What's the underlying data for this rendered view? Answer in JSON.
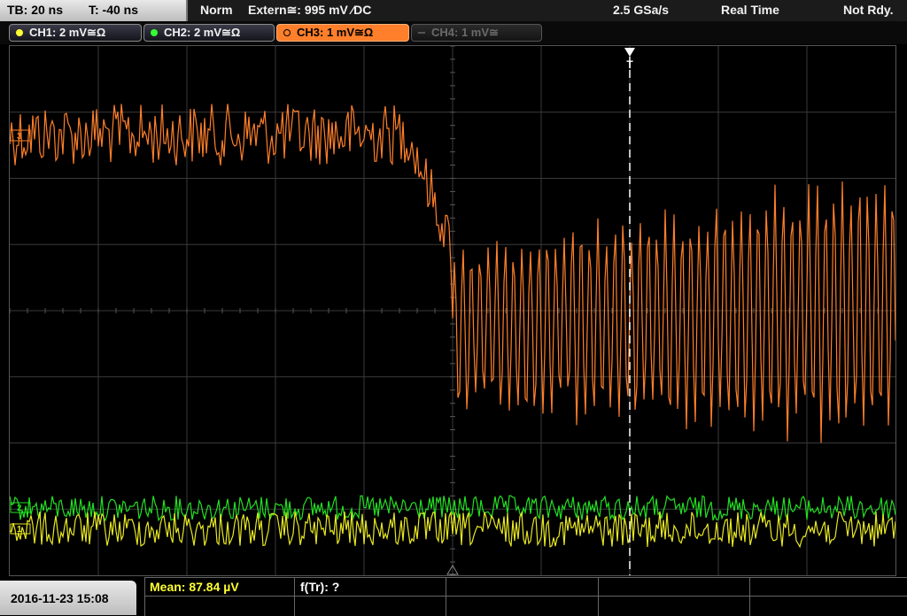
{
  "header": {
    "timebase": "TB: 20 ns",
    "trigger_time": "T: -40 ns",
    "mode": "Norm",
    "trigger_source": "Extern≅: 995 mV ⁄DC",
    "sample_rate": "2.5 GSa/s",
    "acquisition": "Real Time",
    "status": "Not Rdy."
  },
  "channels": [
    {
      "label": "CH1: 2 mV≅Ω",
      "color": "#ffff33",
      "state": "on"
    },
    {
      "label": "CH2: 2 mV≅Ω",
      "color": "#33ff33",
      "state": "on"
    },
    {
      "label": "CH3: 1 mV≅Ω",
      "color": "#ff7f2a",
      "state": "selected"
    },
    {
      "label": "CH4: 1 mV≅",
      "color": "#777777",
      "state": "off"
    }
  ],
  "trace_markers": {
    "ch3": "3",
    "ch2": "2",
    "ch1": "1",
    "trigger": "T"
  },
  "footer": {
    "datetime": "2016-11-23 15:08",
    "measurements": [
      {
        "label": "Mean: 87.84 µV",
        "color": "#ffff33"
      },
      {
        "label": "f(Tr): ?",
        "color": "#ffffff"
      }
    ]
  },
  "colors": {
    "ch1": "#e8e822",
    "ch2": "#22e022",
    "ch3": "#ff7f2a",
    "grid": "#3a3a3a",
    "trigger_line": "#ffffff"
  }
}
